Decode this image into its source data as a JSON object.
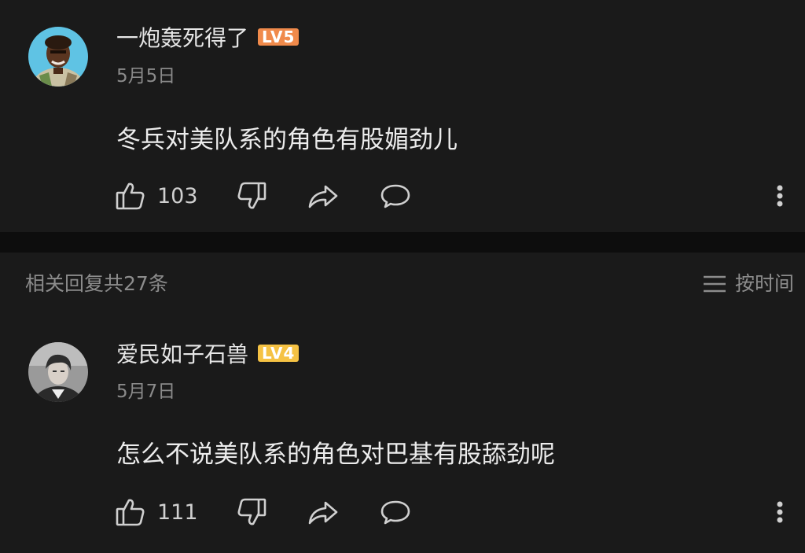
{
  "comments": [
    {
      "username": "一炮轰死得了",
      "level": "LV5",
      "date": "5月5日",
      "text": "冬兵对美队系的角色有股媚劲儿",
      "likes": "103"
    },
    {
      "username": "爱民如子石兽",
      "level": "LV4",
      "date": "5月7日",
      "text": "怎么不说美队系的角色对巴基有股舔劲呢",
      "likes": "111"
    }
  ],
  "replies": {
    "count_label": "相关回复共27条",
    "sort_label": "按时间"
  },
  "icons": {
    "like": "thumbs-up-icon",
    "dislike": "thumbs-down-icon",
    "share": "share-arrow-icon",
    "reply": "speech-bubble-icon",
    "more": "vertical-dots-icon",
    "sort": "hamburger-lines-icon"
  },
  "colors": {
    "background": "#1a1a1a",
    "divider": "#0d0d0d",
    "lv5_badge": "#f08a4b",
    "lv4_badge": "#f5c244",
    "muted_text": "#8c8c8c"
  }
}
